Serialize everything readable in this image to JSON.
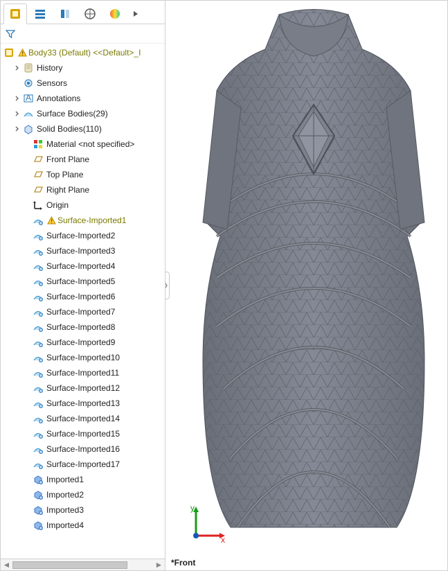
{
  "tree": {
    "root_label": "Body33 (Default) <<Default>_I",
    "root_warning": true,
    "nodes": [
      {
        "id": "history",
        "label": "History",
        "icon": "scroll",
        "expand": true,
        "indent": 1
      },
      {
        "id": "sensors",
        "label": "Sensors",
        "icon": "sensor",
        "expand": false,
        "indent": 1
      },
      {
        "id": "annot",
        "label": "Annotations",
        "icon": "annot",
        "expand": true,
        "indent": 1
      },
      {
        "id": "surfb",
        "label": "Surface Bodies(29)",
        "icon": "surfbody",
        "expand": true,
        "indent": 1
      },
      {
        "id": "solidb",
        "label": "Solid Bodies(110)",
        "icon": "solidbody",
        "expand": true,
        "indent": 1
      },
      {
        "id": "material",
        "label": "Material <not specified>",
        "icon": "material",
        "expand": false,
        "indent": 2
      },
      {
        "id": "fplane",
        "label": "Front Plane",
        "icon": "plane",
        "expand": false,
        "indent": 2
      },
      {
        "id": "tplane",
        "label": "Top Plane",
        "icon": "plane",
        "expand": false,
        "indent": 2
      },
      {
        "id": "rplane",
        "label": "Right Plane",
        "icon": "plane",
        "expand": false,
        "indent": 2
      },
      {
        "id": "origin",
        "label": "Origin",
        "icon": "origin",
        "expand": false,
        "indent": 2
      },
      {
        "id": "si1",
        "label": "Surface-Imported1",
        "icon": "surface",
        "expand": false,
        "indent": 2,
        "warn": true,
        "color": "olive"
      },
      {
        "id": "si2",
        "label": "Surface-Imported2",
        "icon": "surface",
        "expand": false,
        "indent": 2
      },
      {
        "id": "si3",
        "label": "Surface-Imported3",
        "icon": "surface",
        "expand": false,
        "indent": 2
      },
      {
        "id": "si4",
        "label": "Surface-Imported4",
        "icon": "surface",
        "expand": false,
        "indent": 2
      },
      {
        "id": "si5",
        "label": "Surface-Imported5",
        "icon": "surface",
        "expand": false,
        "indent": 2
      },
      {
        "id": "si6",
        "label": "Surface-Imported6",
        "icon": "surface",
        "expand": false,
        "indent": 2
      },
      {
        "id": "si7",
        "label": "Surface-Imported7",
        "icon": "surface",
        "expand": false,
        "indent": 2
      },
      {
        "id": "si8",
        "label": "Surface-Imported8",
        "icon": "surface",
        "expand": false,
        "indent": 2
      },
      {
        "id": "si9",
        "label": "Surface-Imported9",
        "icon": "surface",
        "expand": false,
        "indent": 2
      },
      {
        "id": "si10",
        "label": "Surface-Imported10",
        "icon": "surface",
        "expand": false,
        "indent": 2
      },
      {
        "id": "si11",
        "label": "Surface-Imported11",
        "icon": "surface",
        "expand": false,
        "indent": 2
      },
      {
        "id": "si12",
        "label": "Surface-Imported12",
        "icon": "surface",
        "expand": false,
        "indent": 2
      },
      {
        "id": "si13",
        "label": "Surface-Imported13",
        "icon": "surface",
        "expand": false,
        "indent": 2
      },
      {
        "id": "si14",
        "label": "Surface-Imported14",
        "icon": "surface",
        "expand": false,
        "indent": 2
      },
      {
        "id": "si15",
        "label": "Surface-Imported15",
        "icon": "surface",
        "expand": false,
        "indent": 2
      },
      {
        "id": "si16",
        "label": "Surface-Imported16",
        "icon": "surface",
        "expand": false,
        "indent": 2
      },
      {
        "id": "si17",
        "label": "Surface-Imported17",
        "icon": "surface",
        "expand": false,
        "indent": 2
      },
      {
        "id": "im1",
        "label": "Imported1",
        "icon": "imported",
        "expand": false,
        "indent": 2
      },
      {
        "id": "im2",
        "label": "Imported2",
        "icon": "imported",
        "expand": false,
        "indent": 2
      },
      {
        "id": "im3",
        "label": "Imported3",
        "icon": "imported",
        "expand": false,
        "indent": 2
      },
      {
        "id": "im4",
        "label": "Imported4",
        "icon": "imported",
        "expand": false,
        "indent": 2
      }
    ]
  },
  "triad": {
    "x": "x",
    "y": "y"
  },
  "viewport": {
    "view_label": "*Front"
  }
}
